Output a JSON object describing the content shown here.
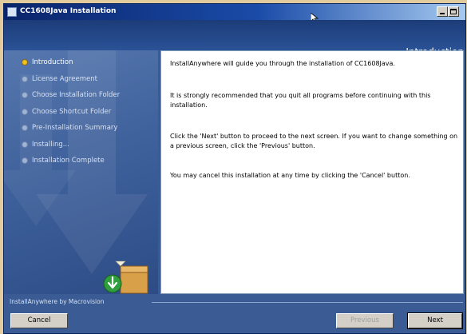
{
  "window": {
    "title": "CC1608Java Installation"
  },
  "header": {
    "page_title": "Introduction"
  },
  "steps": [
    {
      "label": "Introduction",
      "status": "current"
    },
    {
      "label": "License Agreement",
      "status": "pending"
    },
    {
      "label": "Choose Installation Folder",
      "status": "pending"
    },
    {
      "label": "Choose Shortcut Folder",
      "status": "pending"
    },
    {
      "label": "Pre-Installation Summary",
      "status": "pending"
    },
    {
      "label": "Installing...",
      "status": "pending"
    },
    {
      "label": "Installation Complete",
      "status": "pending"
    }
  ],
  "content": {
    "paragraphs": [
      "InstallAnywhere will guide you through the installation of CC1608Java.",
      "It is strongly recommended that you quit all programs before continuing with this installation.",
      "Click the 'Next' button to proceed to the next screen. If you want to change something on a previous screen, click the 'Previous' button.",
      "You may cancel this installation at any time by clicking the 'Cancel' button."
    ]
  },
  "footer": {
    "branding": "InstallAnywhere by Macrovision"
  },
  "buttons": {
    "cancel": "Cancel",
    "previous": "Previous",
    "next": "Next"
  },
  "colors": {
    "window_bg": "#3a5b94",
    "current_step": "#f0c020",
    "content_bg": "#ffffff"
  }
}
